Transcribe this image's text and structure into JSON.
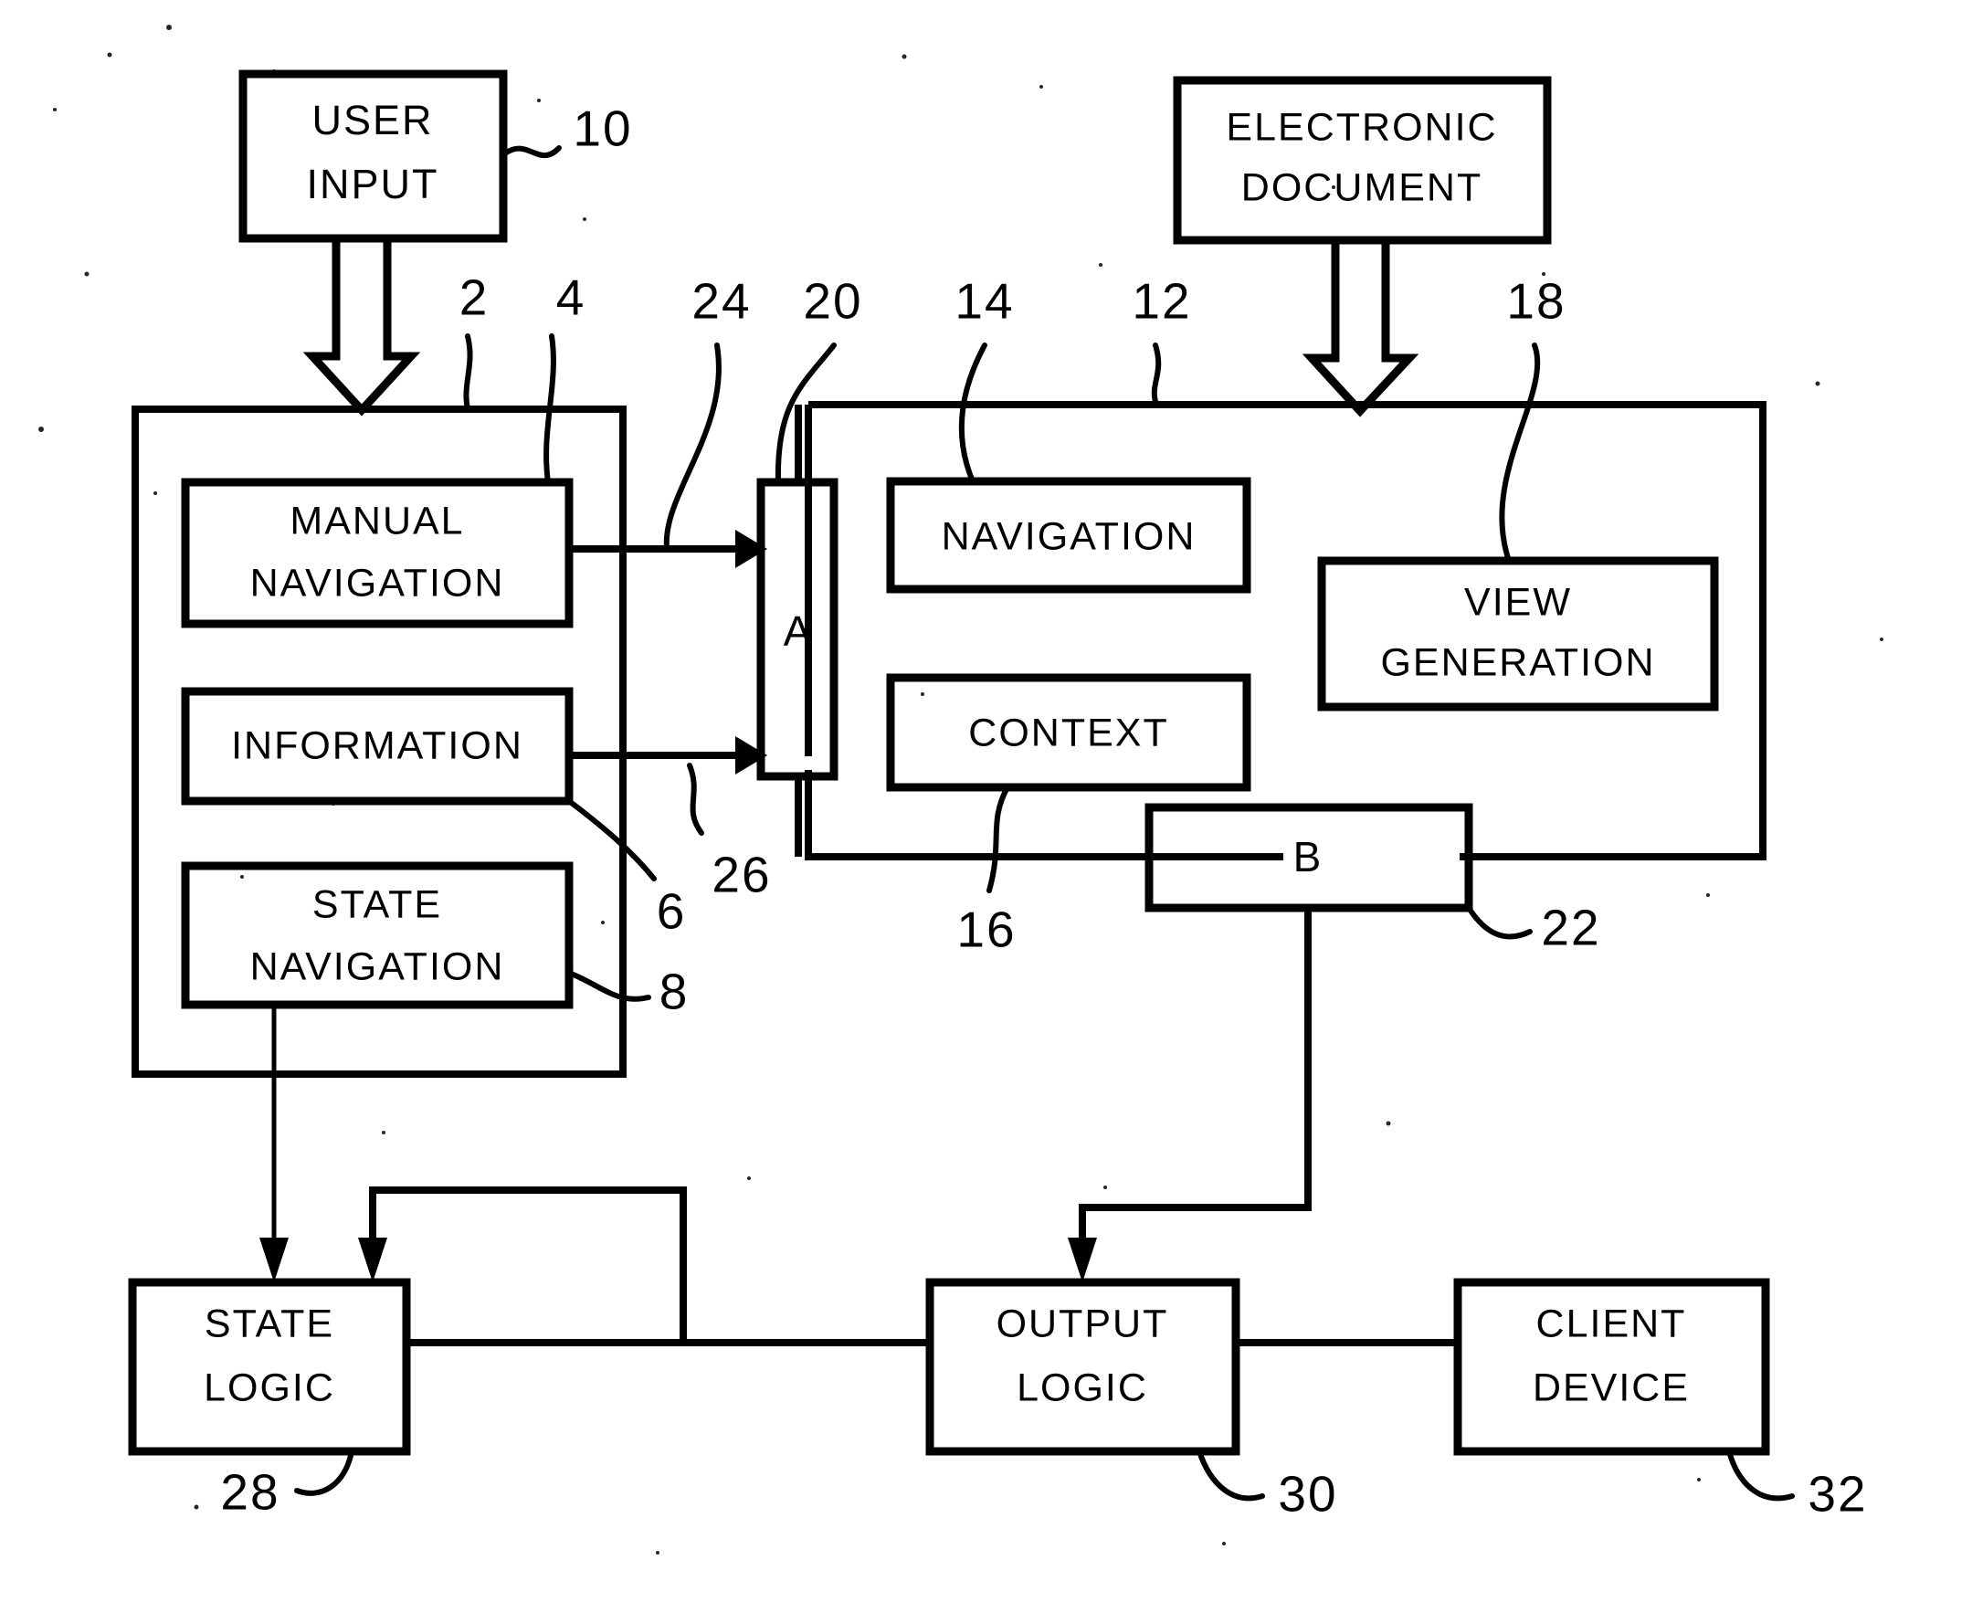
{
  "figure": {
    "type": "patent-block-diagram",
    "background_color": "#ffffff",
    "line_color": "#000000"
  },
  "blocks": {
    "user_input": {
      "line1": "USER",
      "line2": "INPUT",
      "ref": "10"
    },
    "electronic_document": {
      "line1": "ELECTRONIC",
      "line2": "DOCUMENT"
    },
    "manual_navigation": {
      "line1": "MANUAL",
      "line2": "NAVIGATION",
      "ref": "4"
    },
    "information": {
      "line1": "INFORMATION",
      "ref": "6"
    },
    "state_navigation": {
      "line1": "STATE",
      "line2": "NAVIGATION",
      "ref": "8"
    },
    "navigation": {
      "line1": "NAVIGATION",
      "ref": "14"
    },
    "context": {
      "line1": "CONTEXT",
      "ref": "16"
    },
    "view_generation": {
      "line1": "VIEW",
      "line2": "GENERATION",
      "ref": "18"
    },
    "junction_a": {
      "label": "A",
      "ref": "20"
    },
    "junction_b": {
      "label": "B",
      "ref": "22"
    },
    "state_logic": {
      "line1": "STATE",
      "line2": "LOGIC",
      "ref": "28"
    },
    "output_logic": {
      "line1": "OUTPUT",
      "line2": "LOGIC",
      "ref": "30"
    },
    "client_device": {
      "line1": "CLIENT",
      "line2": "DEVICE",
      "ref": "32"
    }
  },
  "containers": {
    "left_panel": {
      "ref": "2"
    },
    "right_panel": {
      "ref": "12"
    }
  },
  "reference_numerals": {
    "ten": "10",
    "two": "2",
    "four": "4",
    "twentyfour": "24",
    "twenty": "20",
    "fourteen": "14",
    "twelve": "12",
    "eighteen": "18",
    "six": "6",
    "twentysix": "26",
    "eight": "8",
    "sixteen": "16",
    "twentytwo": "22",
    "twentyeight": "28",
    "thirty": "30",
    "thirtytwo": "32"
  }
}
